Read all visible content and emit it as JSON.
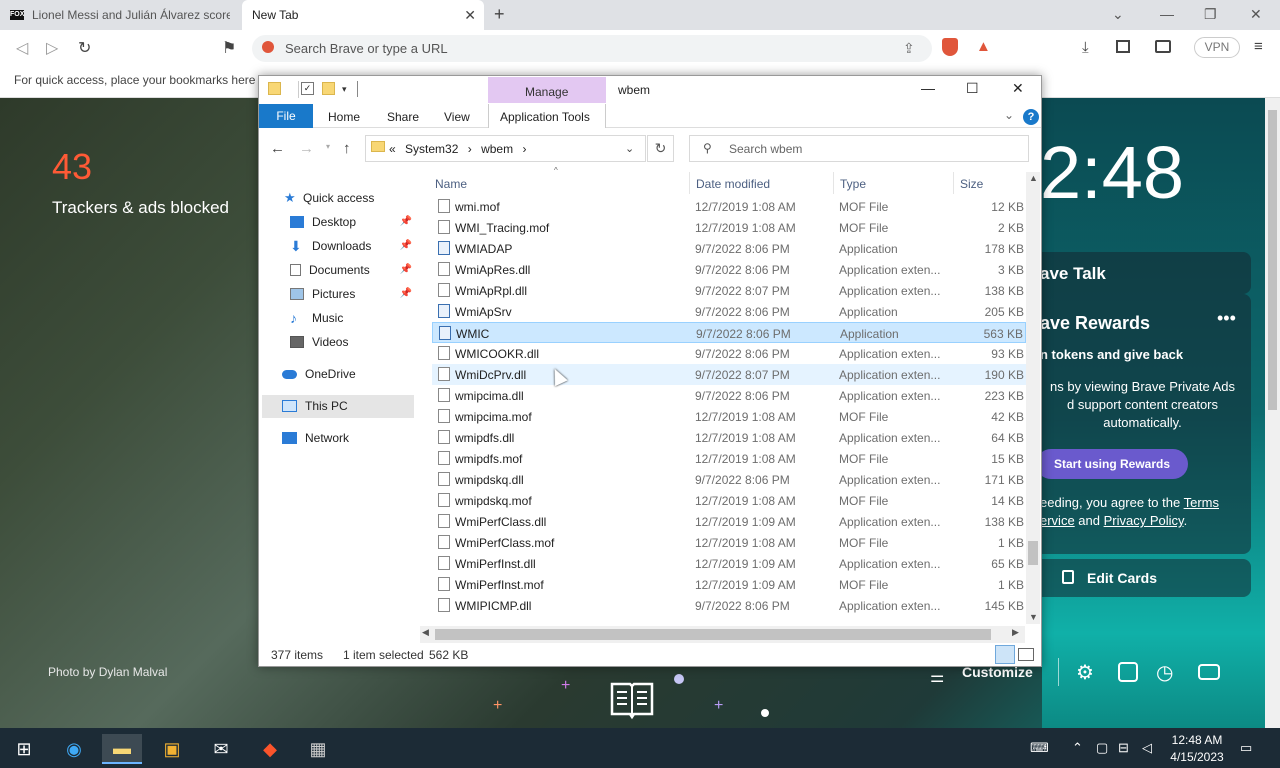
{
  "browser": {
    "tabs": [
      {
        "label": "Lionel Messi and Julián Álvarez score t",
        "favicon": "FOX"
      },
      {
        "label": "New Tab"
      }
    ],
    "omnibox_placeholder": "Search Brave or type a URL",
    "vpn_label": "VPN",
    "bookmark_hint": "For quick access, place your bookmarks here o"
  },
  "ntp": {
    "trackers_count": "43",
    "trackers_label": "Trackers & ads blocked",
    "clock": "2:48",
    "talk_title": "ave Talk",
    "rewards_title": "ave Rewards",
    "rewards_sub": "n tokens and give back",
    "rewards_desc": "ns by viewing Brave Private Ads\nd support content creators\nautomatically.",
    "rewards_button": "Start using Rewards",
    "terms_prefix": "eeding, you agree to the ",
    "terms_link1": "Terms",
    "terms_mid_link": "ervice",
    "terms_and": " and ",
    "terms_link2": "Privacy Policy",
    "terms_end": ".",
    "edit_cards": "Edit Cards",
    "customize": "Customize",
    "photo_credit": "Photo by Dylan Malval"
  },
  "explorer": {
    "window_title": "wbem",
    "manage_tab": "Manage",
    "ribbon_tabs": {
      "file": "File",
      "home": "Home",
      "share": "Share",
      "view": "View",
      "app_tools": "Application Tools"
    },
    "path": {
      "prefix": "«",
      "seg1": "System32",
      "sep": "›",
      "seg2": "wbem"
    },
    "search_placeholder": "Search wbem",
    "nav": {
      "quick_access": "Quick access",
      "desktop": "Desktop",
      "downloads": "Downloads",
      "documents": "Documents",
      "pictures": "Pictures",
      "music": "Music",
      "videos": "Videos",
      "onedrive": "OneDrive",
      "this_pc": "This PC",
      "network": "Network"
    },
    "columns": {
      "name": "Name",
      "date": "Date modified",
      "type": "Type",
      "size": "Size"
    },
    "files": [
      {
        "name": "wmi.mof",
        "date": "12/7/2019 1:08 AM",
        "type": "MOF File",
        "size": "12 KB"
      },
      {
        "name": "WMI_Tracing.mof",
        "date": "12/7/2019 1:08 AM",
        "type": "MOF File",
        "size": "2 KB"
      },
      {
        "name": "WMIADAP",
        "date": "9/7/2022 8:06 PM",
        "type": "Application",
        "size": "178 KB"
      },
      {
        "name": "WmiApRes.dll",
        "date": "9/7/2022 8:06 PM",
        "type": "Application exten...",
        "size": "3 KB"
      },
      {
        "name": "WmiApRpl.dll",
        "date": "9/7/2022 8:07 PM",
        "type": "Application exten...",
        "size": "138 KB"
      },
      {
        "name": "WmiApSrv",
        "date": "9/7/2022 8:06 PM",
        "type": "Application",
        "size": "205 KB"
      },
      {
        "name": "WMIC",
        "date": "9/7/2022 8:06 PM",
        "type": "Application",
        "size": "563 KB"
      },
      {
        "name": "WMICOOKR.dll",
        "date": "9/7/2022 8:06 PM",
        "type": "Application exten...",
        "size": "93 KB"
      },
      {
        "name": "WmiDcPrv.dll",
        "date": "9/7/2022 8:07 PM",
        "type": "Application exten...",
        "size": "190 KB"
      },
      {
        "name": "wmipcima.dll",
        "date": "9/7/2022 8:06 PM",
        "type": "Application exten...",
        "size": "223 KB"
      },
      {
        "name": "wmipcima.mof",
        "date": "12/7/2019 1:08 AM",
        "type": "MOF File",
        "size": "42 KB"
      },
      {
        "name": "wmipdfs.dll",
        "date": "12/7/2019 1:08 AM",
        "type": "Application exten...",
        "size": "64 KB"
      },
      {
        "name": "wmipdfs.mof",
        "date": "12/7/2019 1:08 AM",
        "type": "MOF File",
        "size": "15 KB"
      },
      {
        "name": "wmipdskq.dll",
        "date": "9/7/2022 8:06 PM",
        "type": "Application exten...",
        "size": "171 KB"
      },
      {
        "name": "wmipdskq.mof",
        "date": "12/7/2019 1:08 AM",
        "type": "MOF File",
        "size": "14 KB"
      },
      {
        "name": "WmiPerfClass.dll",
        "date": "12/7/2019 1:09 AM",
        "type": "Application exten...",
        "size": "138 KB"
      },
      {
        "name": "WmiPerfClass.mof",
        "date": "12/7/2019 1:08 AM",
        "type": "MOF File",
        "size": "1 KB"
      },
      {
        "name": "WmiPerfInst.dll",
        "date": "12/7/2019 1:09 AM",
        "type": "Application exten...",
        "size": "65 KB"
      },
      {
        "name": "WmiPerfInst.mof",
        "date": "12/7/2019 1:09 AM",
        "type": "MOF File",
        "size": "1 KB"
      },
      {
        "name": "WMIPICMP.dll",
        "date": "9/7/2022 8:06 PM",
        "type": "Application exten...",
        "size": "145 KB"
      }
    ],
    "status": {
      "count": "377 items",
      "selected": "1 item selected",
      "size": "562 KB"
    }
  },
  "taskbar": {
    "time": "12:48 AM",
    "date": "4/15/2023"
  }
}
